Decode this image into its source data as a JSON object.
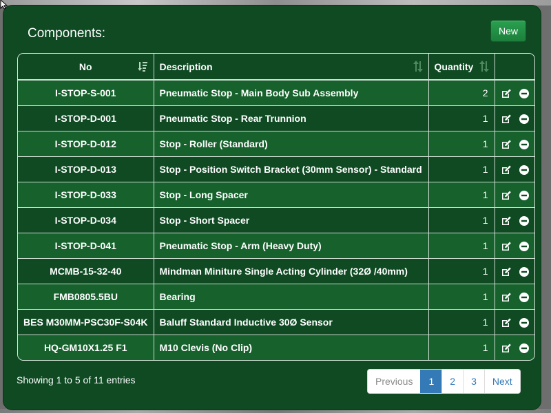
{
  "panel": {
    "title": "Components:",
    "new_label": "New"
  },
  "table": {
    "headers": {
      "no": "No",
      "description": "Description",
      "quantity": "Quantity"
    },
    "rows": [
      {
        "no": "I-STOP-S-001",
        "description": "Pneumatic Stop - Main Body Sub Assembly",
        "quantity": "2"
      },
      {
        "no": "I-STOP-D-001",
        "description": "Pneumatic Stop - Rear Trunnion",
        "quantity": "1"
      },
      {
        "no": "I-STOP-D-012",
        "description": "Stop - Roller (Standard)",
        "quantity": "1"
      },
      {
        "no": "I-STOP-D-013",
        "description": "Stop - Position Switch Bracket (30mm Sensor) - Standard",
        "quantity": "1"
      },
      {
        "no": "I-STOP-D-033",
        "description": "Stop - Long Spacer",
        "quantity": "1"
      },
      {
        "no": "I-STOP-D-034",
        "description": "Stop - Short Spacer",
        "quantity": "1"
      },
      {
        "no": "I-STOP-D-041",
        "description": "Pneumatic Stop - Arm (Heavy Duty)",
        "quantity": "1"
      },
      {
        "no": "MCMB-15-32-40",
        "description": "Mindman Miniture Single Acting Cylinder (32Ø /40mm)",
        "quantity": "1"
      },
      {
        "no": "FMB0805.5BU",
        "description": "Bearing",
        "quantity": "1"
      },
      {
        "no": "BES M30MM-PSC30F-S04K",
        "description": "Baluff Standard Inductive 30Ø Sensor",
        "quantity": "1"
      },
      {
        "no": "HQ-GM10X1.25 F1",
        "description": "M10 Clevis (No Clip)",
        "quantity": "1"
      }
    ],
    "row_icons": [
      "edit-icon",
      "remove-icon"
    ]
  },
  "footer": {
    "info": "Showing 1 to 5 of 11 entries",
    "pagination": {
      "previous": "Previous",
      "pages": [
        "1",
        "2",
        "3"
      ],
      "active_page": "1",
      "next": "Next"
    }
  },
  "colors": {
    "panel_bg": "#0f4a23",
    "row_odd": "#17612d",
    "row_even": "#0f4a23",
    "button_green": "#1f8a42",
    "pagination_active": "#337ab7"
  }
}
